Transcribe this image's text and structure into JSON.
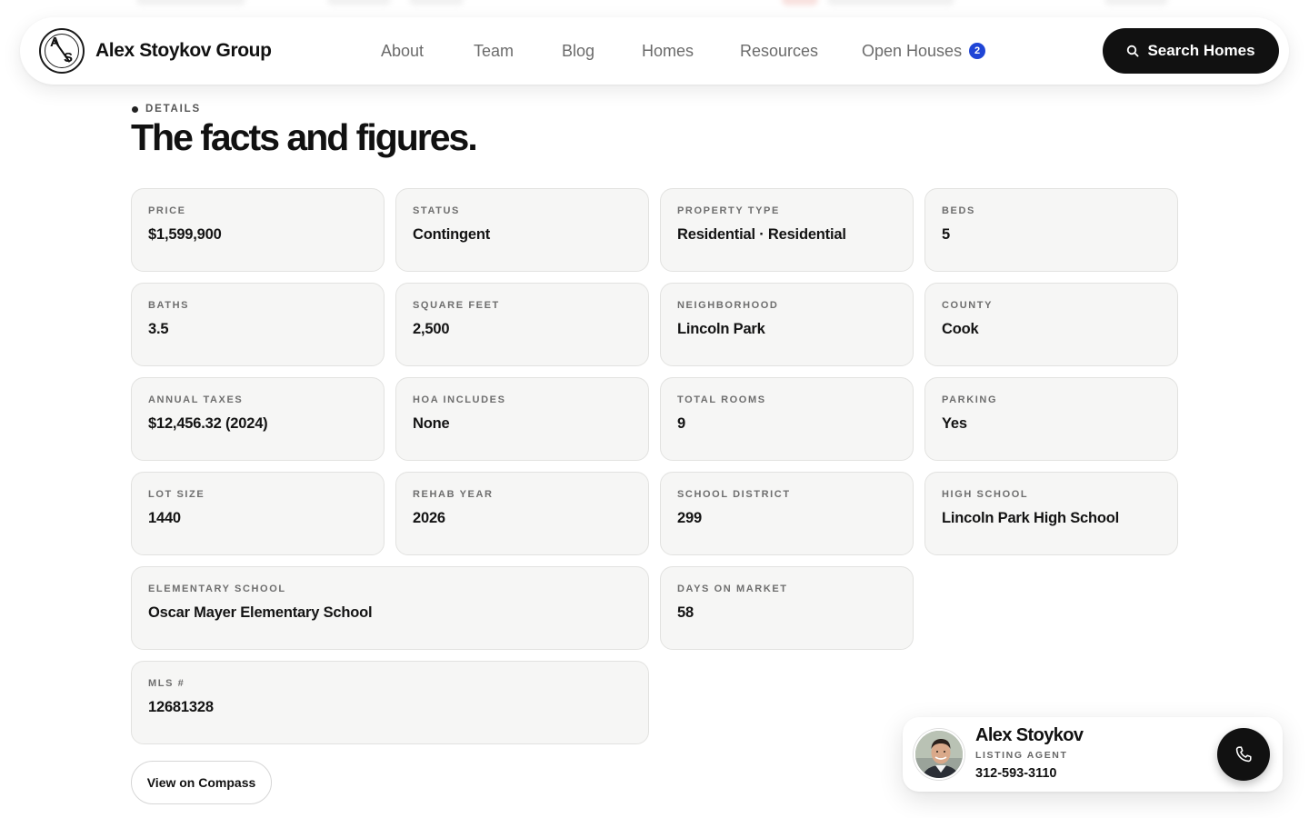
{
  "header": {
    "brand_name": "Alex Stoykov Group",
    "logo_letters": {
      "top": "A",
      "bottom": "S"
    },
    "nav": [
      {
        "label": "About"
      },
      {
        "label": "Team"
      },
      {
        "label": "Blog"
      },
      {
        "label": "Homes"
      },
      {
        "label": "Resources"
      },
      {
        "label": "Open Houses",
        "badge": "2"
      }
    ],
    "search_label": "Search Homes",
    "search_icon": "search-icon",
    "badge_color": "#1f45d6"
  },
  "section": {
    "eyebrow": "DETAILS",
    "title": "The facts and figures."
  },
  "facts": [
    {
      "label": "PRICE",
      "value": "$1,599,900"
    },
    {
      "label": "STATUS",
      "value": "Contingent"
    },
    {
      "label": "PROPERTY TYPE",
      "value": "Residential · Residential"
    },
    {
      "label": "BEDS",
      "value": "5"
    },
    {
      "label": "BATHS",
      "value": "3.5"
    },
    {
      "label": "SQUARE FEET",
      "value": "2,500"
    },
    {
      "label": "NEIGHBORHOOD",
      "value": "Lincoln Park"
    },
    {
      "label": "COUNTY",
      "value": "Cook"
    },
    {
      "label": "ANNUAL TAXES",
      "value": "$12,456.32 (2024)"
    },
    {
      "label": "HOA INCLUDES",
      "value": "None"
    },
    {
      "label": "TOTAL ROOMS",
      "value": "9"
    },
    {
      "label": "PARKING",
      "value": "Yes"
    },
    {
      "label": "LOT SIZE",
      "value": "1440"
    },
    {
      "label": "REHAB YEAR",
      "value": "2026"
    },
    {
      "label": "SCHOOL DISTRICT",
      "value": "299"
    },
    {
      "label": "HIGH SCHOOL",
      "value": "Lincoln Park High School"
    },
    {
      "label": "ELEMENTARY SCHOOL",
      "value": "Oscar Mayer Elementary School"
    },
    {
      "label": "DAYS ON MARKET",
      "value": "58"
    },
    {
      "label": "MLS #",
      "value": "12681328"
    }
  ],
  "compass_button": "View on Compass",
  "agent": {
    "name": "Alex Stoykov",
    "role": "LISTING AGENT",
    "phone": "312-593-3110",
    "call_icon": "phone-icon"
  }
}
